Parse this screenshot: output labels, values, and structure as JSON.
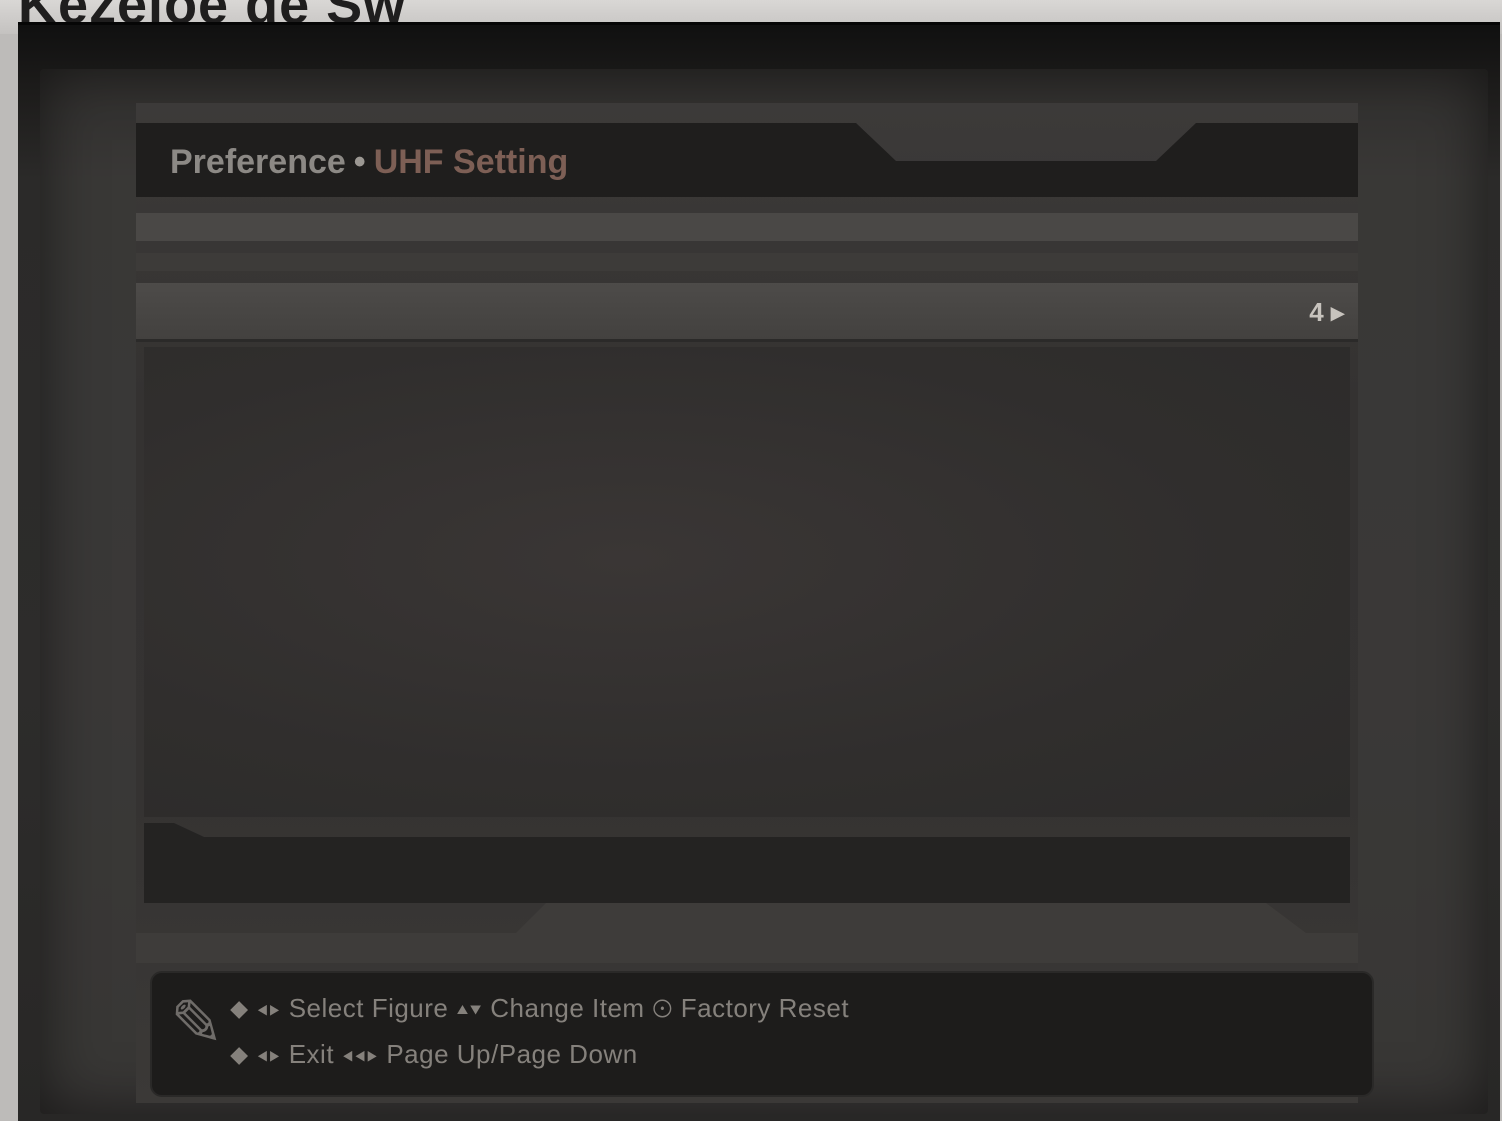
{
  "paper": {
    "heading": "Kezeloe de Sw"
  },
  "osd": {
    "breadcrumb": {
      "section": "Preference",
      "separator": "•",
      "subsection": "UHF Setting"
    },
    "menu_row": {
      "value": "4 ▸"
    },
    "help": {
      "line1": "⬥ ◂▸ Select Figure   ▴▾ Change Item   ⊙ Factory Reset",
      "line2": "⬥ ◂▸ Exit   ◂◂▸ Page Up/Page Down"
    },
    "icons": {
      "help": "pencil-icon"
    }
  },
  "colors": {
    "bezel": "#2b2a29",
    "header_bar": "#1f1e1d",
    "subsection_accent": "#7d5f55"
  }
}
